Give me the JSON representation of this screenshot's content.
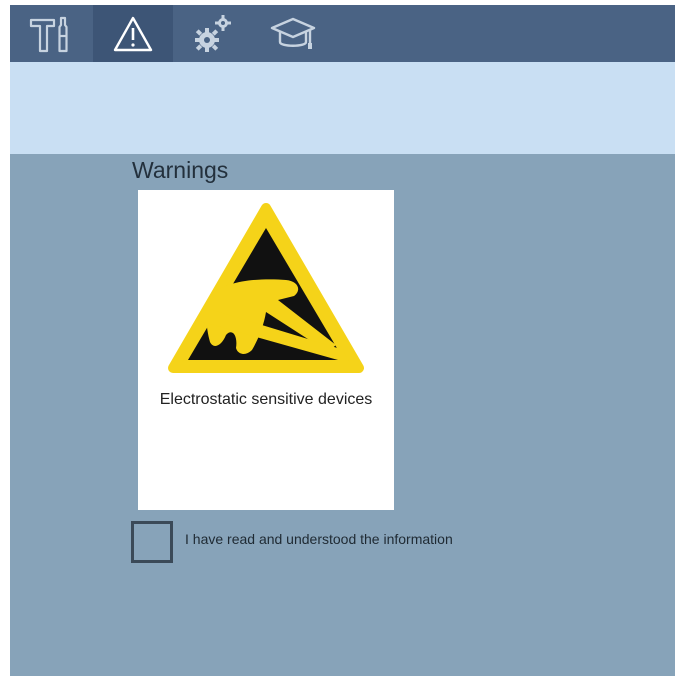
{
  "nav": {
    "tabs": [
      {
        "icon": "tools-icon",
        "active": false
      },
      {
        "icon": "warning-icon",
        "active": true
      },
      {
        "icon": "gears-icon",
        "active": false
      },
      {
        "icon": "graduation-cap-icon",
        "active": false
      }
    ]
  },
  "section": {
    "title": "Warnings"
  },
  "warning_card": {
    "icon": "esd-warning-icon",
    "label": "Electrostatic sensitive devices"
  },
  "acknowledgement": {
    "checked": false,
    "label": "I have read and understood the information"
  },
  "colors": {
    "nav_bg": "#4a6384",
    "active_tab": "#3d5576",
    "banner": "#c9dff3",
    "content_bg": "#87a3b9",
    "warning_yellow": "#f5d319"
  }
}
